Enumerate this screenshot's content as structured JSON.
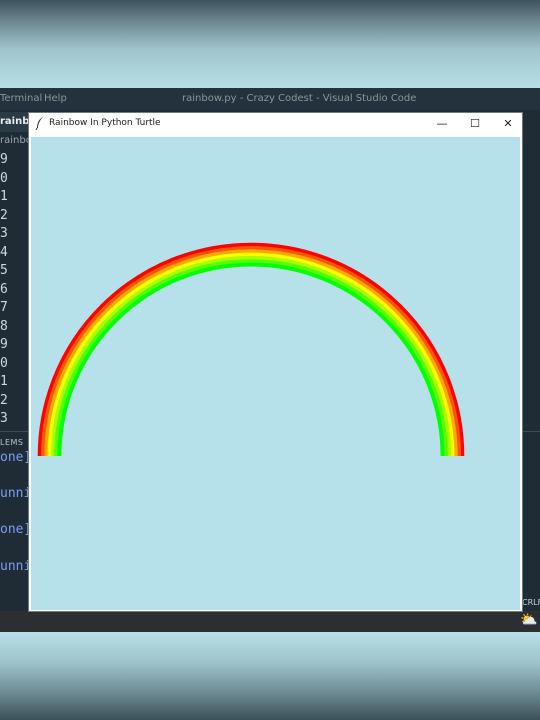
{
  "vscode": {
    "menu": [
      "Terminal",
      "Help"
    ],
    "title": "rainbow.py - Crazy Codest - Visual Studio Code",
    "tab_label": "rainbow.py",
    "breadcrumb": "rainbow",
    "line_numbers": [
      "9",
      "0",
      "1",
      "2",
      "3",
      "4",
      "5",
      "6",
      "7",
      "8",
      "9",
      "0",
      "1",
      "2",
      "3"
    ],
    "panel_label": "LEMS",
    "terminal_lines": [
      "one]",
      "unni",
      "one]",
      "unni"
    ],
    "status_right": "CRLF"
  },
  "turtle_window": {
    "title": "Rainbow In Python Turtle",
    "controls": {
      "minimize": "—",
      "maximize": "☐",
      "close": "✕"
    }
  },
  "rainbow": {
    "colors": [
      "#ff0000",
      "#ff5500",
      "#ffaa00",
      "#ffff00",
      "#aaff00",
      "#55ff00",
      "#00ff00"
    ],
    "shape": "semicircle"
  },
  "colors": {
    "canvas_background": "#b6e1ea",
    "vscode_background": "#1f2c36",
    "terminal_text": "#7f9cf5"
  }
}
